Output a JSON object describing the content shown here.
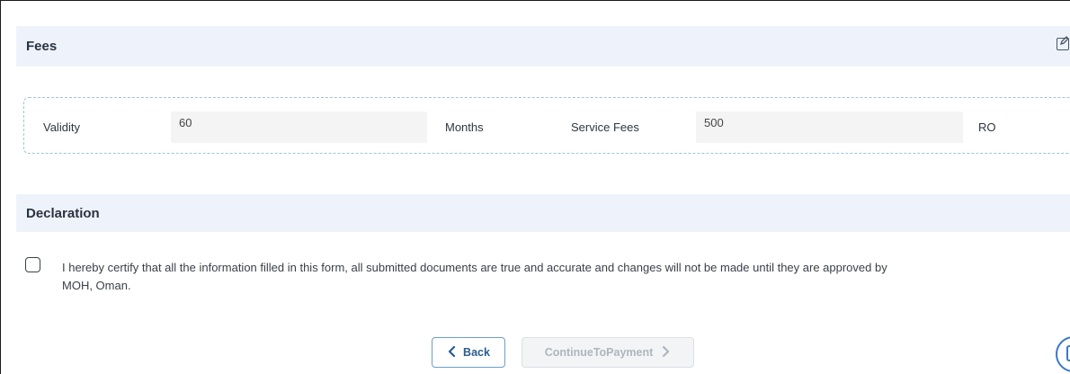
{
  "fees": {
    "title": "Fees",
    "validity_label": "Validity",
    "validity_value": "60",
    "validity_unit": "Months",
    "service_fees_label": "Service Fees",
    "service_fees_value": "500",
    "service_fees_unit": "RO"
  },
  "declaration": {
    "title": "Declaration",
    "checked": false,
    "text": "I hereby certify that all the information filled in this form, all submitted documents are true and accurate and changes will not be made until they are approved by MOH, Oman."
  },
  "actions": {
    "back_label": "Back",
    "continue_label": "ContinueToPayment",
    "continue_disabled": true
  },
  "icons": {
    "edit": "edit-icon",
    "back": "chevron-left-icon",
    "continue": "chevron-right-icon",
    "floating": "document-icon"
  },
  "colors": {
    "section_header_bg": "#eef3fb",
    "accent": "#2b5d8c",
    "dashed_border": "#9fc4d6",
    "disabled_text": "#b0b5bd"
  }
}
